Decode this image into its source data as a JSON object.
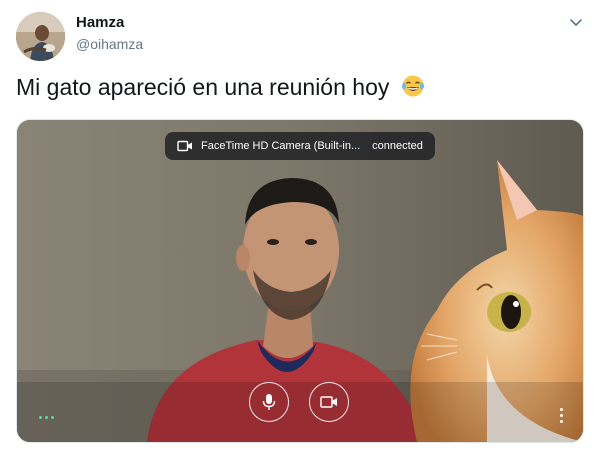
{
  "author": {
    "name": "Hamza",
    "handle": "@oihamza"
  },
  "tweet": {
    "text": "Mi gato apareció en una reunión hoy",
    "emoji_icon": "face-with-tears-of-joy-icon"
  },
  "call_overlay": {
    "camera_name": "FaceTime HD Camera (Built-in...",
    "status": "connected",
    "mic_icon": "microphone-icon",
    "video_icon": "video-camera-icon",
    "more_icon": "more-vertical-icon"
  },
  "colors": {
    "name_text": "#14171a",
    "handle_text": "#657786",
    "chip_bg": "#202124",
    "activity_dots": "#64d2a5"
  }
}
